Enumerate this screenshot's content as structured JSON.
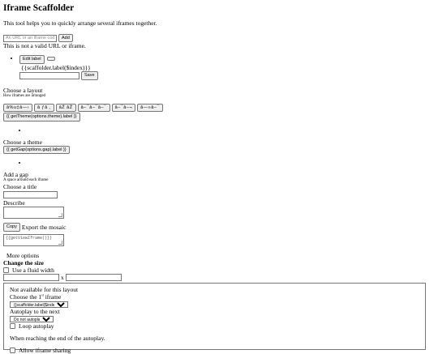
{
  "page": {
    "title": "Iframe Scaffolder",
    "intro": "This tool helps you to quickly arrange several iframes together."
  },
  "add": {
    "placeholder": "An URL or an iframe code",
    "button_label": "Add",
    "error": "This is not a valid URL or iframe."
  },
  "scaffold_item": {
    "edit_button": "Edit label",
    "label_template": "{{scaffolder.label($index)}}",
    "save_button": "Save"
  },
  "layout": {
    "heading": "Choose a layout",
    "hint": "How iframes are arranged",
    "options": [
      "â%u‡â—›",
      "â  ƒâ  ,",
      "âŽ  âŽ",
      "â–¯â–¯â–¯",
      "â–¯â–¬",
      "â—»â–¯"
    ],
    "theme_label": "{{ getTheme(options.theme).label }}"
  },
  "theme": {
    "heading": "Choose a theme",
    "gap_label": "{{ getGap(options.gap).label }}"
  },
  "gap": {
    "heading": "Add a gap",
    "hint": "A space around each iframe"
  },
  "title_field": {
    "label": "Choose a title"
  },
  "describe_field": {
    "label": "Describe"
  },
  "export": {
    "copy_button": "Copy",
    "label": "Export the mosaic",
    "code_template": "{{getViewIframe()}}"
  },
  "more": {
    "toggle": "More options",
    "size_heading": "Change the size",
    "fluid_label": "Use a fluid width",
    "times": "x"
  },
  "advanced": {
    "not_available": "Not available for this layout",
    "choose_prefix": "Choose the 1",
    "choose_sup": "st",
    "choose_suffix": " iframe",
    "choose_select": "{{scaffolder.label($index)}}",
    "autoplay_label": "Autoplay to the next",
    "autoplay_select": "Do not autoplay",
    "loop_label": "Loop autoplay",
    "end_label": "When reaching the end of the autoplay.",
    "sharing_label": "Allow iframe sharing"
  }
}
